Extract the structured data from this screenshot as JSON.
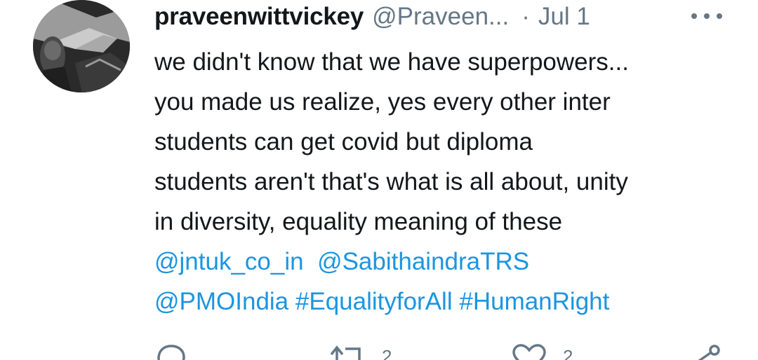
{
  "tweet": {
    "display_name": "praveenwittvickey",
    "handle": "@Praveen...",
    "separator": "·",
    "date": "Jul 1",
    "text_lines": [
      "we didn't know that we have superpowers...",
      "you made us realize, yes every other inter",
      "students can get covid but diploma",
      "students aren't that's what is all about, unity",
      "in diversity, equality meaning of these"
    ],
    "mentions_line1": [
      "@jntuk_co_in",
      "@SabithaindraTRS"
    ],
    "mentions_line2": [
      "@PMOIndia",
      "#EqualityforAll",
      "#HumanRight"
    ],
    "retweet_count": "2",
    "like_count": "2"
  },
  "colors": {
    "text": "#14171a",
    "secondary": "#657786",
    "link": "#1b95e0"
  },
  "icons": [
    "more-icon",
    "reply-icon",
    "retweet-icon",
    "like-icon",
    "share-icon"
  ]
}
